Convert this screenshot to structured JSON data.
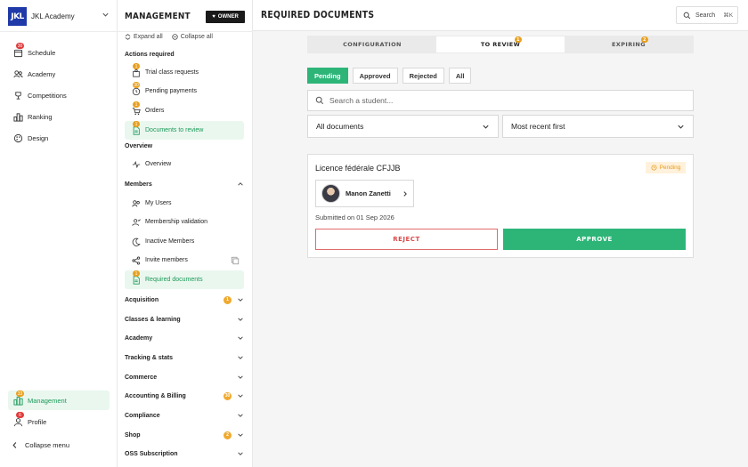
{
  "org": {
    "logo_text": "JKL",
    "name": "JKL Academy"
  },
  "left_nav": {
    "items": [
      {
        "label": "Schedule",
        "badge": "30",
        "icon": "calendar-icon"
      },
      {
        "label": "Academy",
        "icon": "users-icon"
      },
      {
        "label": "Competitions",
        "icon": "trophy-icon"
      },
      {
        "label": "Ranking",
        "icon": "ranking-icon"
      },
      {
        "label": "Design",
        "icon": "palette-icon"
      }
    ],
    "bottom": [
      {
        "label": "Management",
        "badge": "33",
        "icon": "management-icon",
        "active": true
      },
      {
        "label": "Profile",
        "badge": "6",
        "icon": "profile-icon"
      }
    ],
    "collapse_label": "Collapse menu"
  },
  "management": {
    "title": "MANAGEMENT",
    "owner_label": "OWNER",
    "expand_all": "Expand all",
    "collapse_all": "Collapse all",
    "actions_required": {
      "title": "Actions required",
      "items": [
        {
          "label": "Trial class requests",
          "badge": "1"
        },
        {
          "label": "Pending payments",
          "badge": "30"
        },
        {
          "label": "Orders",
          "badge": "1"
        },
        {
          "label": "Documents to review",
          "badge": "1",
          "active": true
        }
      ]
    },
    "overview": {
      "title": "Overview",
      "items": [
        {
          "label": "Overview"
        }
      ]
    },
    "members": {
      "title": "Members",
      "items": [
        {
          "label": "My Users"
        },
        {
          "label": "Membership validation"
        },
        {
          "label": "Inactive Members"
        },
        {
          "label": "Invite members"
        },
        {
          "label": "Required documents",
          "badge": "1",
          "active": true
        }
      ]
    },
    "sections": [
      {
        "label": "Acquisition",
        "badge": "1"
      },
      {
        "label": "Classes & learning"
      },
      {
        "label": "Academy"
      },
      {
        "label": "Tracking & stats"
      },
      {
        "label": "Commerce"
      },
      {
        "label": "Accounting & Billing",
        "badge": "30"
      },
      {
        "label": "Compliance"
      },
      {
        "label": "Shop",
        "badge": "2"
      },
      {
        "label": "OSS Subscription"
      }
    ]
  },
  "header": {
    "title": "REQUIRED DOCUMENTS",
    "search_label": "Search",
    "search_shortcut": "⌘K"
  },
  "tabs": [
    {
      "label": "CONFIGURATION"
    },
    {
      "label": "TO REVIEW",
      "badge": "1",
      "active": true
    },
    {
      "label": "EXPIRING",
      "badge": "2"
    }
  ],
  "filters": [
    {
      "label": "Pending",
      "active": true
    },
    {
      "label": "Approved"
    },
    {
      "label": "Rejected"
    },
    {
      "label": "All"
    }
  ],
  "student_search_placeholder": "Search a student...",
  "doc_select": "All documents",
  "sort_select": "Most recent first",
  "card": {
    "title": "Licence fédérale CFJJB",
    "status": "Pending",
    "user": "Manon Zanetti",
    "submitted": "Submitted on 01 Sep 2026",
    "reject": "REJECT",
    "approve": "APPROVE"
  },
  "colors": {
    "accent": "#2db578",
    "danger": "#d84a4a",
    "warning": "#e8a020",
    "brand": "#1f3aa8"
  }
}
